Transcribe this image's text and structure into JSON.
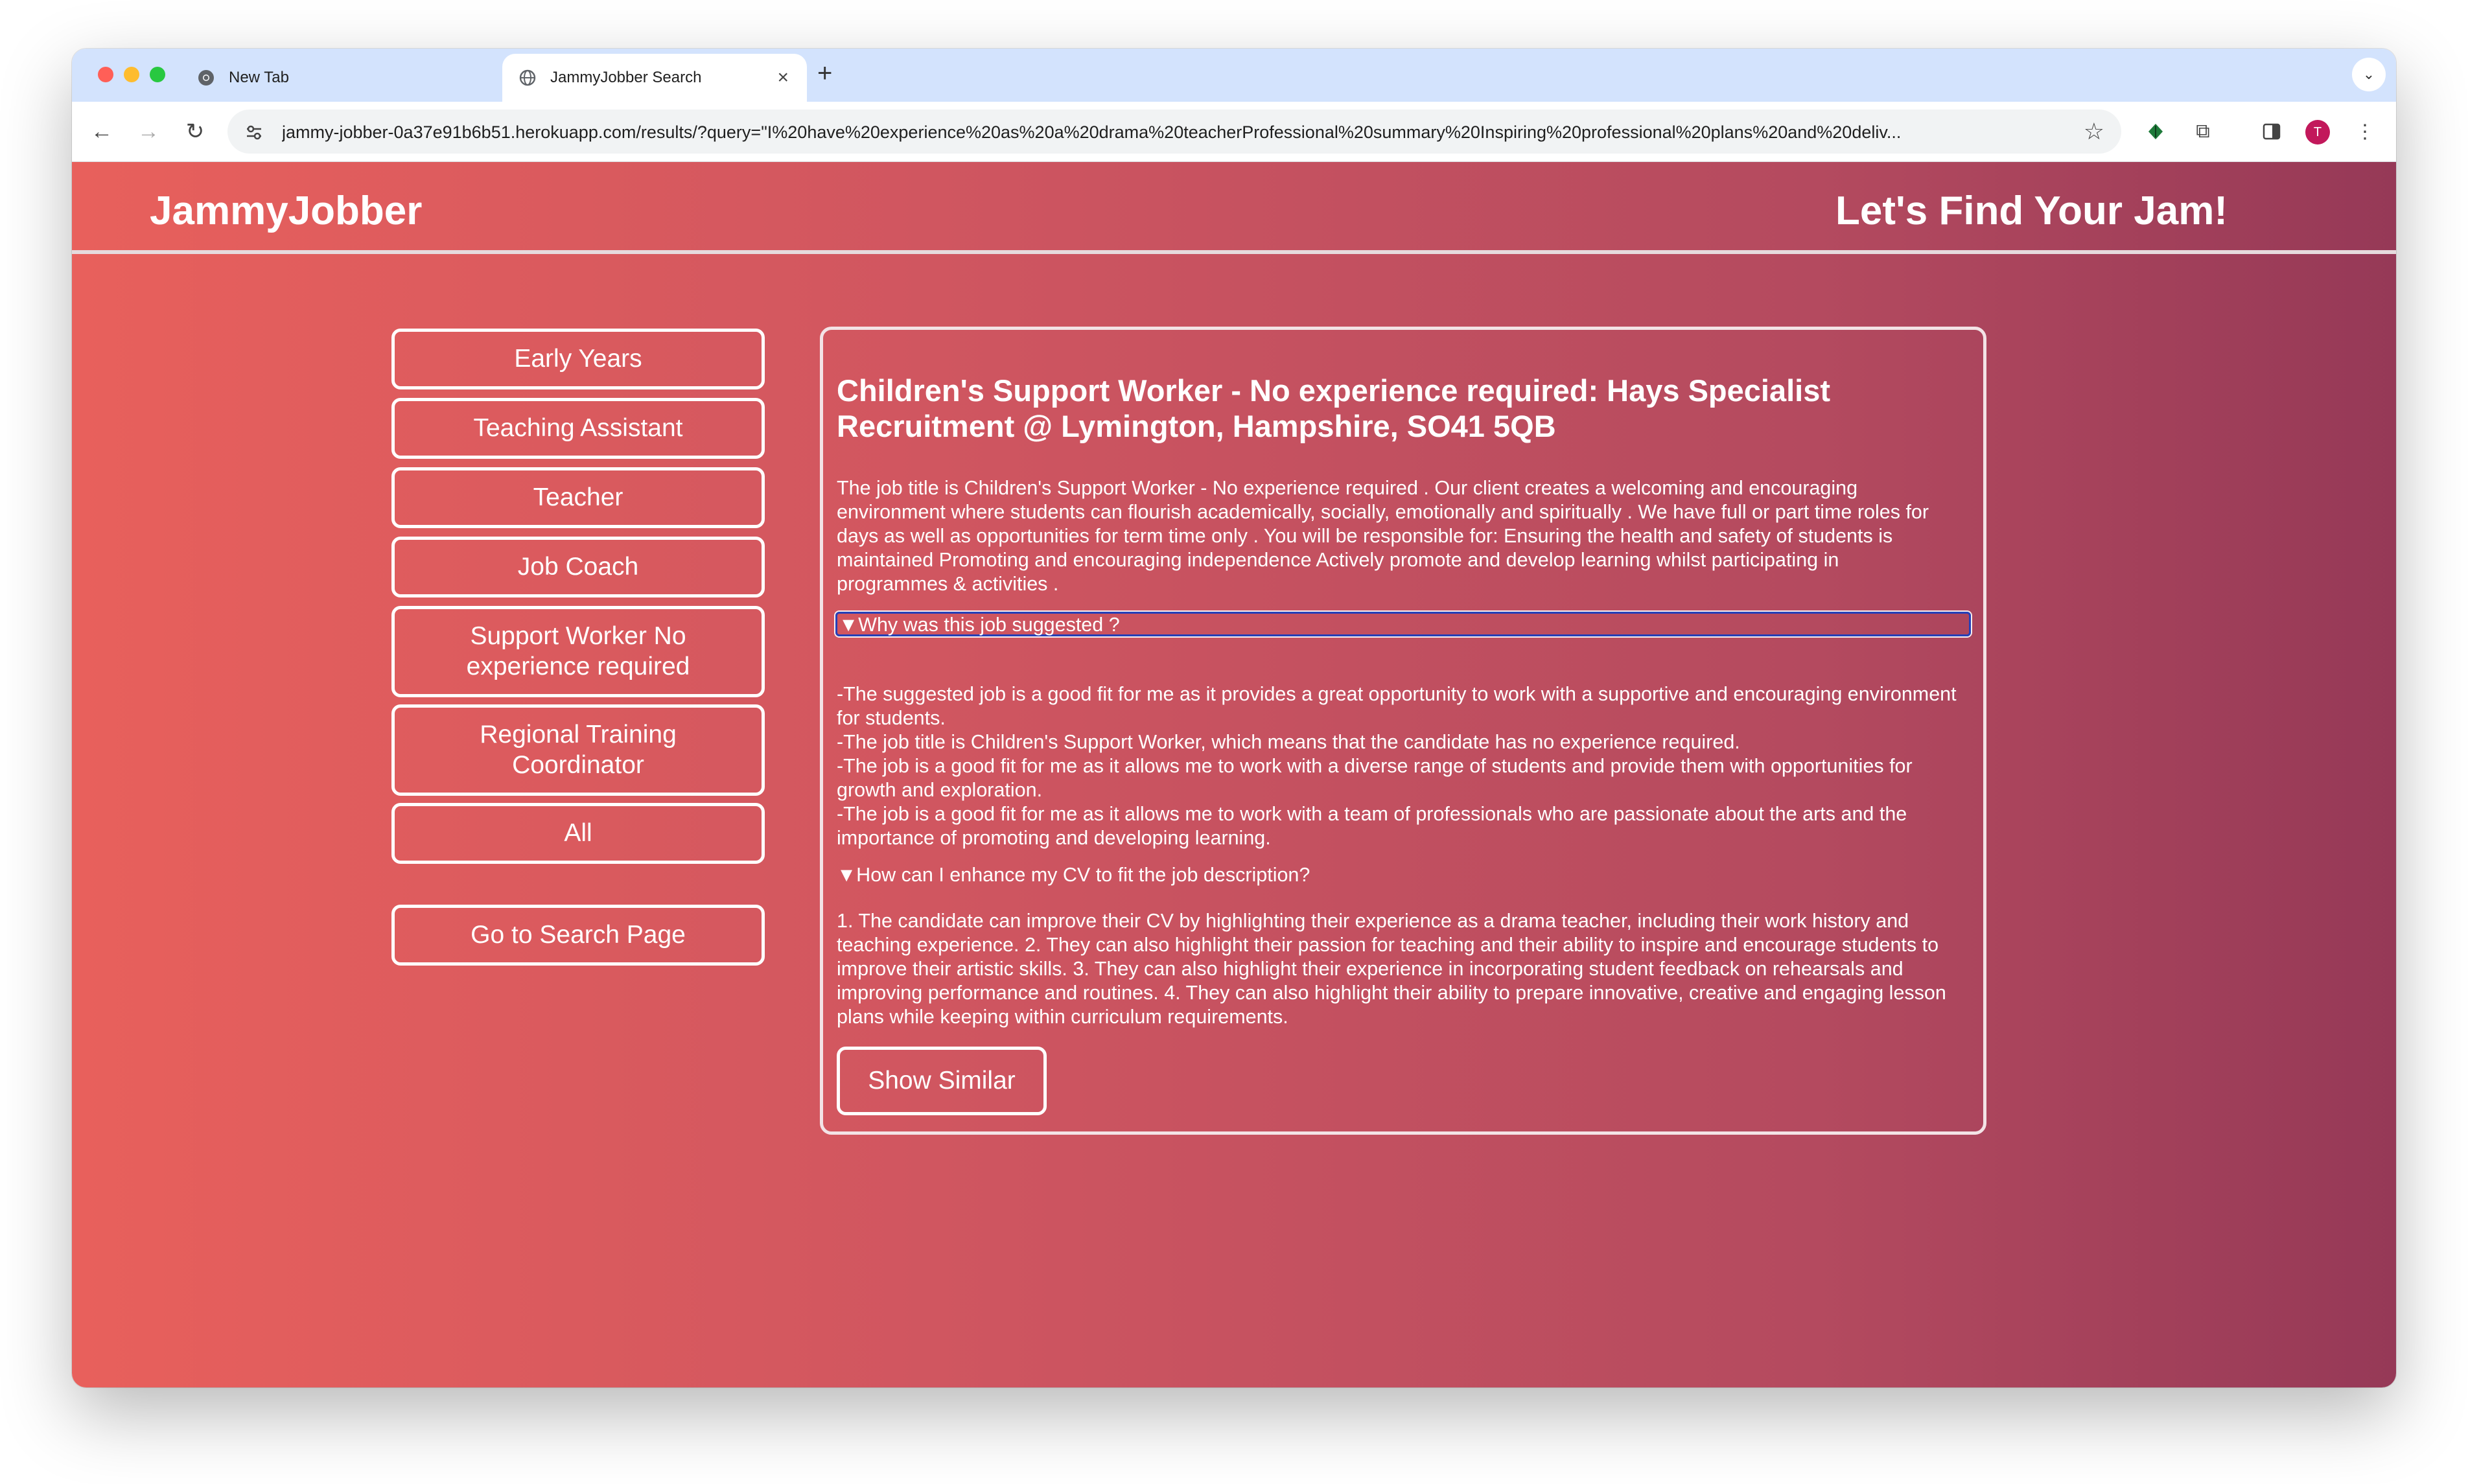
{
  "browser": {
    "tabs": [
      {
        "title": "New Tab",
        "icon": "chrome-icon"
      },
      {
        "title": "JammyJobber Search",
        "icon": "globe-icon"
      }
    ],
    "url": "jammy-jobber-0a37e91b6b51.herokuapp.com/results/?query=\"I%20have%20experience%20as%20a%20drama%20teacherProfessional%20summary%20Inspiring%20professional%20plans%20and%20deliv...",
    "profile_initial": "T"
  },
  "site": {
    "brand": "JammyJobber",
    "tagline": "Let's Find Your Jam!"
  },
  "sidebar": {
    "categories": [
      "Early Years",
      "Teaching Assistant",
      "Teacher",
      "Job Coach",
      "Support Worker No experience required",
      "Regional Training Coordinator",
      "All"
    ],
    "search_button": "Go to Search Page"
  },
  "job": {
    "title": "Children's Support Worker - No experience required: Hays Specialist Recruitment @ Lymington, Hampshire, SO41 5QB",
    "description": "The job title is Children's Support Worker - No experience required . Our client creates a welcoming and encouraging environment where students can flourish academically, socially, emotionally and spiritually . We have full or part time roles for days as well as opportunities for term time only . You will be responsible for: Ensuring the health and safety of students is maintained Promoting and encouraging independence Actively promote and develop learning whilst participating in programmes & activities .",
    "why_label": "▼Why was this job suggested ?",
    "why_points": [
      "-The suggested job is a good fit for me as it provides a great opportunity to work with a supportive and encouraging environment for students.",
      "-The job title is Children's Support Worker, which means that the candidate has no experience required.",
      "-The job is a good fit for me as it allows me to work with a diverse range of students and provide them with opportunities for growth and exploration.",
      "-The job is a good fit for me as it allows me to work with a team of professionals who are passionate about the arts and the importance of promoting and developing learning."
    ],
    "cv_label": "▼How can I enhance my CV to fit the job description?",
    "cv_text": "1. The candidate can improve their CV by highlighting their experience as a drama teacher, including their work history and teaching experience. 2. They can also highlight their passion for teaching and their ability to inspire and encourage students to improve their artistic skills. 3. They can also highlight their experience in incorporating student feedback on rehearsals and improving performance and routines. 4. They can also highlight their ability to prepare innovative, creative and engaging lesson plans while keeping within curriculum requirements.",
    "similar_button": "Show Similar"
  }
}
